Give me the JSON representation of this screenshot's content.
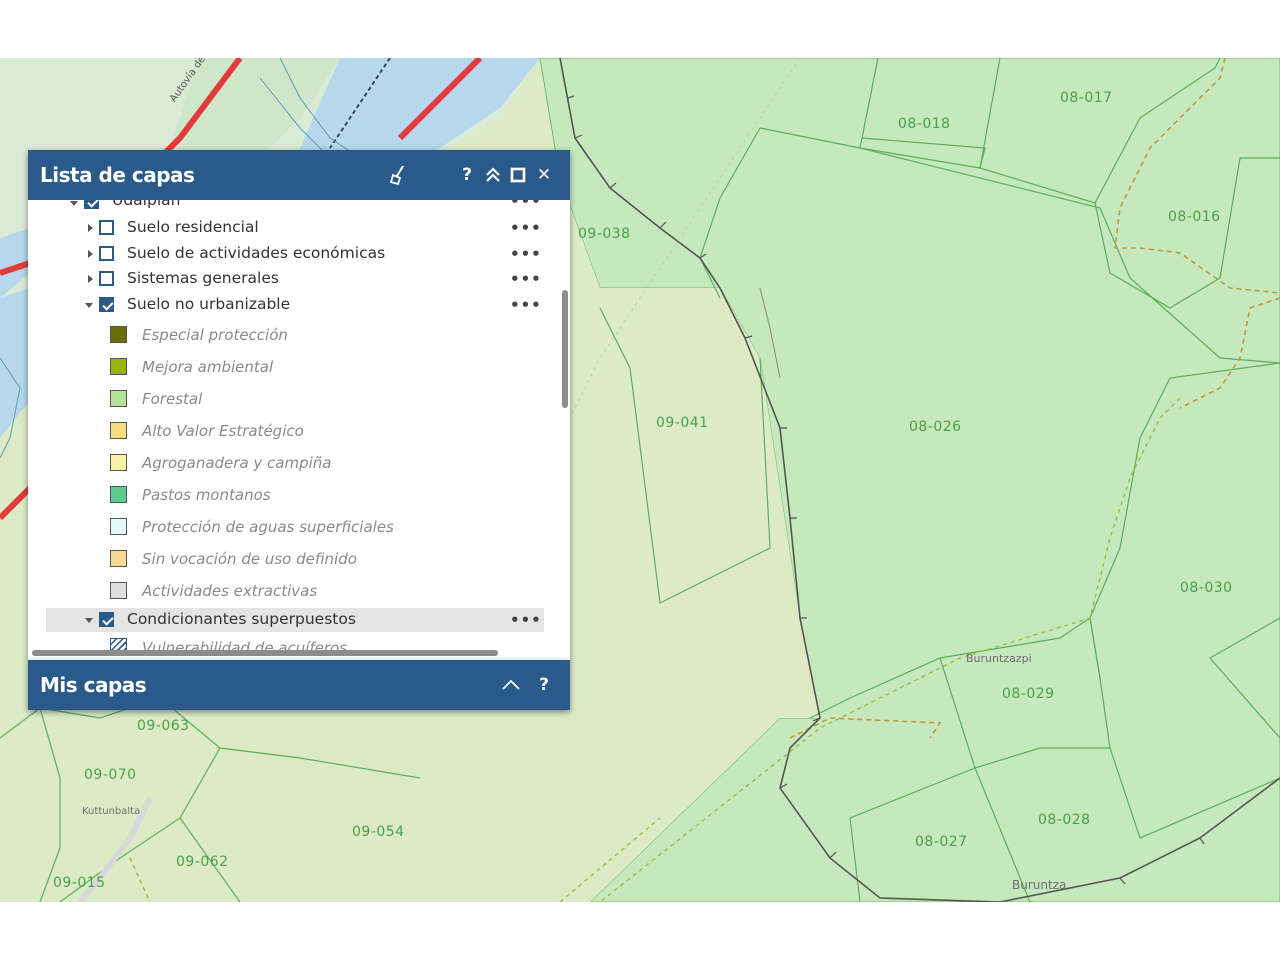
{
  "map": {
    "parcels": [
      "09-038",
      "08-018",
      "08-017",
      "08-016",
      "09-041",
      "08-026",
      "08-030",
      "08-029",
      "08-028",
      "08-027",
      "09-063",
      "09-070",
      "09-054",
      "09-062",
      "09-015"
    ],
    "places": [
      "Buruntzazpi",
      "Buruntza",
      "Kuttunbalta",
      "Autovía de Aba"
    ],
    "colors": {
      "background": "#dcebc6",
      "parcel_fill": "#c6e8bd",
      "parcel_stroke": "#4aa04a",
      "road": "#e23b3b",
      "water": "#a6cfe8"
    }
  },
  "layers_panel": {
    "title": "Lista de capas",
    "icons": [
      "broom-icon",
      "help-icon",
      "collapse-icon",
      "maximize-icon",
      "close-icon"
    ],
    "help_label": "?",
    "close_label": "✕",
    "partial_top_label": "Udalplan",
    "items": [
      {
        "label": "Suelo residencial",
        "checked": false,
        "more": "•••"
      },
      {
        "label": "Suelo de actividades económicas",
        "checked": false,
        "more": "•••"
      },
      {
        "label": "Sistemas generales",
        "checked": false,
        "more": "•••"
      },
      {
        "label": "Suelo no urbanizable",
        "checked": true,
        "more": "•••"
      }
    ],
    "legend": [
      {
        "label": "Especial protección",
        "color": "#6b6e07"
      },
      {
        "label": "Mejora ambiental",
        "color": "#9ab30e"
      },
      {
        "label": "Forestal",
        "color": "#b5e39a"
      },
      {
        "label": "Alto Valor Estratégico",
        "color": "#f7dc82"
      },
      {
        "label": "Agroganadera y campiña",
        "color": "#f7f2a6"
      },
      {
        "label": "Pastos montanos",
        "color": "#5cc98f"
      },
      {
        "label": "Protección de aguas superficiales",
        "color": "#e5fbfd"
      },
      {
        "label": "Sin vocación de uso definido",
        "color": "#f5d996"
      },
      {
        "label": "Actividades extractivas",
        "color": "#dedede"
      }
    ],
    "overlay": {
      "label": "Condicionantes superpuestos",
      "checked": true,
      "more": "•••"
    },
    "partial_bottom_label": "Vulnerabilidad de acuíferos"
  },
  "my_layers_panel": {
    "title": "Mis capas",
    "help_label": "?"
  }
}
